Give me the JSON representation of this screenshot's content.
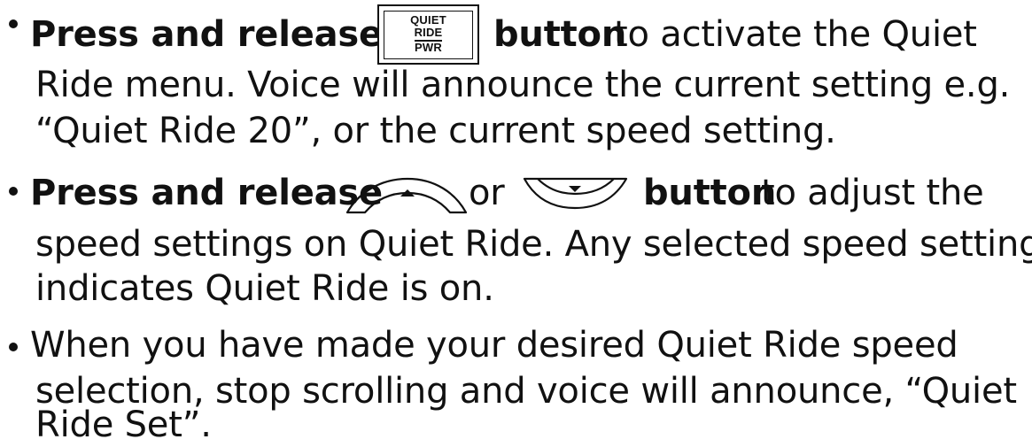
{
  "document": {
    "items": [
      {
        "lines": [
          {
            "bold_start": "Press and release",
            "bold_end": "button",
            "rest": " to activate the Quiet"
          },
          {
            "text": "Ride menu. Voice will announce the current setting e.g."
          },
          {
            "text": "“Quiet Ride 20”, or the current speed setting."
          }
        ],
        "button": {
          "label_top": "QUIET",
          "label_mid": "RIDE",
          "label_bottom": "PWR"
        }
      },
      {
        "lines": [
          {
            "bold_start": "Press and release",
            "middle": " or ",
            "bold_end": "button",
            "rest": " to adjust the"
          },
          {
            "text": "speed settings on Quiet Ride. Any selected speed setting"
          },
          {
            "text": "indicates Quiet Ride is on."
          }
        ]
      },
      {
        "lines": [
          {
            "text": "When you have made your desired Quiet Ride speed"
          },
          {
            "text": "selection, stop scrolling and voice will announce, “Quiet"
          },
          {
            "text": "Ride Set”."
          }
        ]
      }
    ]
  },
  "icons": {
    "up_arrow": "up-arrow-button-icon",
    "down_arrow": "down-arrow-button-icon",
    "bullet": "bullet-icon"
  },
  "colors": {
    "text": "#111111",
    "background": "#ffffff"
  }
}
